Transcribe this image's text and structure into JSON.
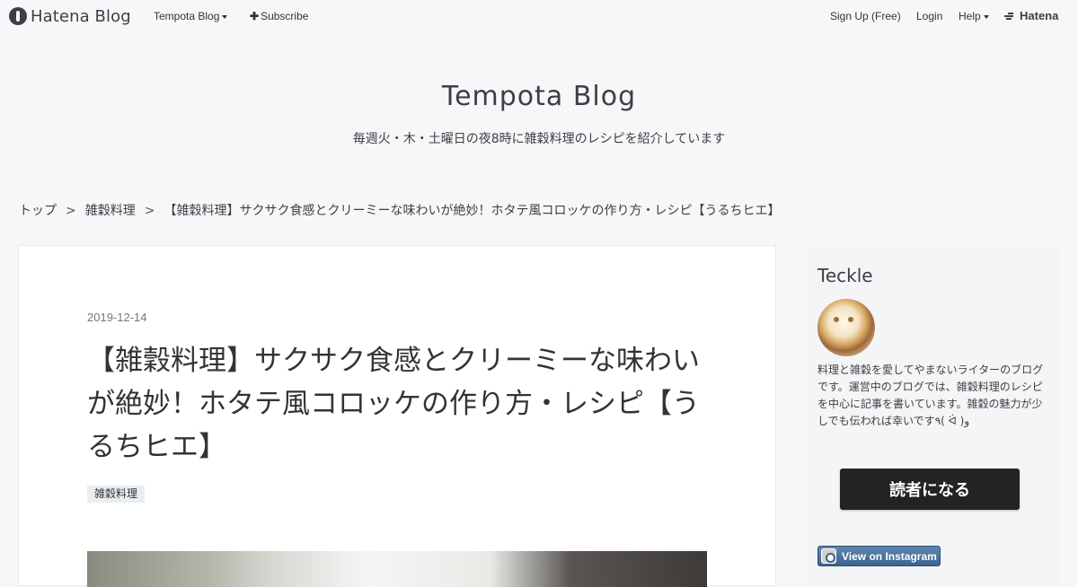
{
  "global_header": {
    "logo_text": "Hatena Blog",
    "blog_menu_label": "Tempota Blog",
    "subscribe_label": "Subscribe",
    "signup_label": "Sign Up (Free)",
    "login_label": "Login",
    "help_label": "Help",
    "hatena_label": "Hatena"
  },
  "blog": {
    "title": "Tempota Blog",
    "description": "毎週火・木・土曜日の夜8時に雑穀料理のレシピを紹介しています"
  },
  "breadcrumb": {
    "items": [
      "トップ",
      "雑穀料理",
      "【雑穀料理】サクサク食感とクリーミーな味わいが絶妙！ホタテ風コロッケの作り方・レシピ【うるちヒエ】"
    ],
    "separator": ">"
  },
  "article": {
    "date": "2019-12-14",
    "title": "【雑穀料理】サクサク食感とクリーミーな味わいが絶妙！ホタテ風コロッケの作り方・レシピ【うるちヒエ】",
    "category": "雑穀料理"
  },
  "sidebar": {
    "author_name": "Teckle",
    "description": "料理と雑穀を愛してやまないライターのブログです。運営中のブログでは、雑穀料理のレシピを中心に記事を書いています。雑穀の魅力が少しでも伝われば幸いです٩( ᐛ )و",
    "follow_button": "読者になる",
    "instagram_button": "View on Instagram"
  },
  "colors": {
    "background": "#f6f7f8",
    "text": "#3d3f44",
    "follow_button_bg": "#232323",
    "instagram_button_bg": "#3d6491"
  }
}
